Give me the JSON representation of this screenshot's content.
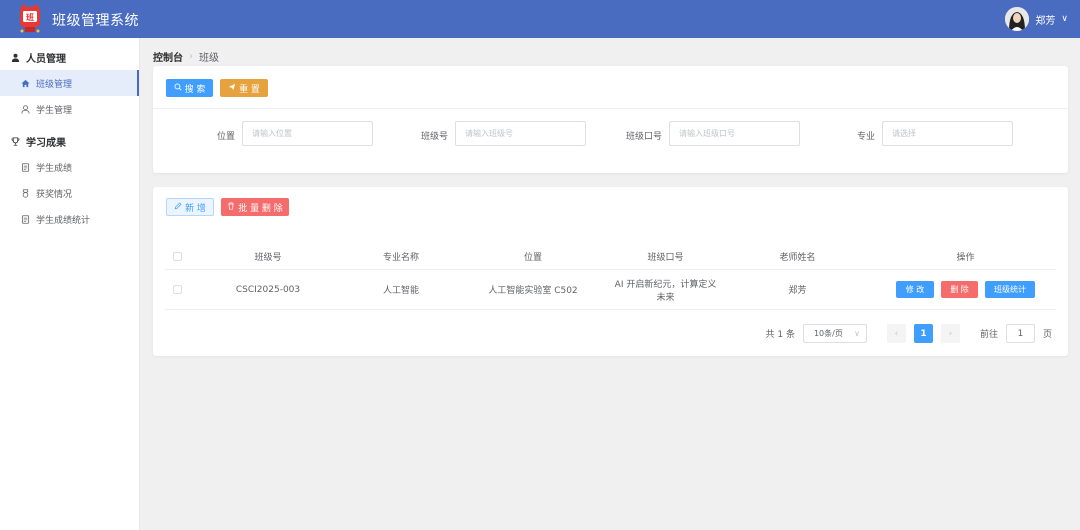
{
  "header": {
    "title": "班级管理系统",
    "logo_text": "班",
    "user_name": "郑芳"
  },
  "sidebar": {
    "groups": [
      {
        "label": "人员管理",
        "icon": "user-icon",
        "items": [
          {
            "label": "班级管理",
            "icon": "home-icon",
            "active": true
          },
          {
            "label": "学生管理",
            "icon": "user-icon",
            "active": false
          }
        ]
      },
      {
        "label": "学习成果",
        "icon": "trophy-icon",
        "items": [
          {
            "label": "学生成绩",
            "icon": "document-icon",
            "active": false
          },
          {
            "label": "获奖情况",
            "icon": "medal-icon",
            "active": false
          },
          {
            "label": "学生成绩统计",
            "icon": "document-icon",
            "active": false
          }
        ]
      }
    ]
  },
  "breadcrumb": {
    "home": "控制台",
    "current": "班级"
  },
  "search_card": {
    "search_label": "搜 索",
    "reset_label": "重 置",
    "fields": [
      {
        "label": "位置",
        "placeholder": "请输入位置"
      },
      {
        "label": "班级号",
        "placeholder": "请输入班级号"
      },
      {
        "label": "班级口号",
        "placeholder": "请输入班级口号"
      },
      {
        "label": "专业",
        "placeholder": "请选择"
      }
    ]
  },
  "table_card": {
    "add_label": "新 增",
    "batch_delete_label": "批 量 删 除",
    "columns": [
      "班级号",
      "专业名称",
      "位置",
      "班级口号",
      "老师姓名",
      "操作"
    ],
    "rows": [
      {
        "code": "CSCI2025-003",
        "major": "人工智能",
        "location": "人工智能实验室 C502",
        "slogan": "AI 开启新纪元，计算定义未来",
        "teacher": "郑芳",
        "actions": [
          "修 改",
          "删 除",
          "班级统计"
        ]
      }
    ]
  },
  "pagination": {
    "total_text": "共 1 条",
    "page_size": "10条/页",
    "current_page": "1",
    "goto_label": "前往",
    "goto_value": "1",
    "page_suffix": "页"
  },
  "colors": {
    "header_bg": "#4a6cc0",
    "primary": "#409eff",
    "warning": "#e6a23c",
    "danger": "#f56c6c"
  }
}
